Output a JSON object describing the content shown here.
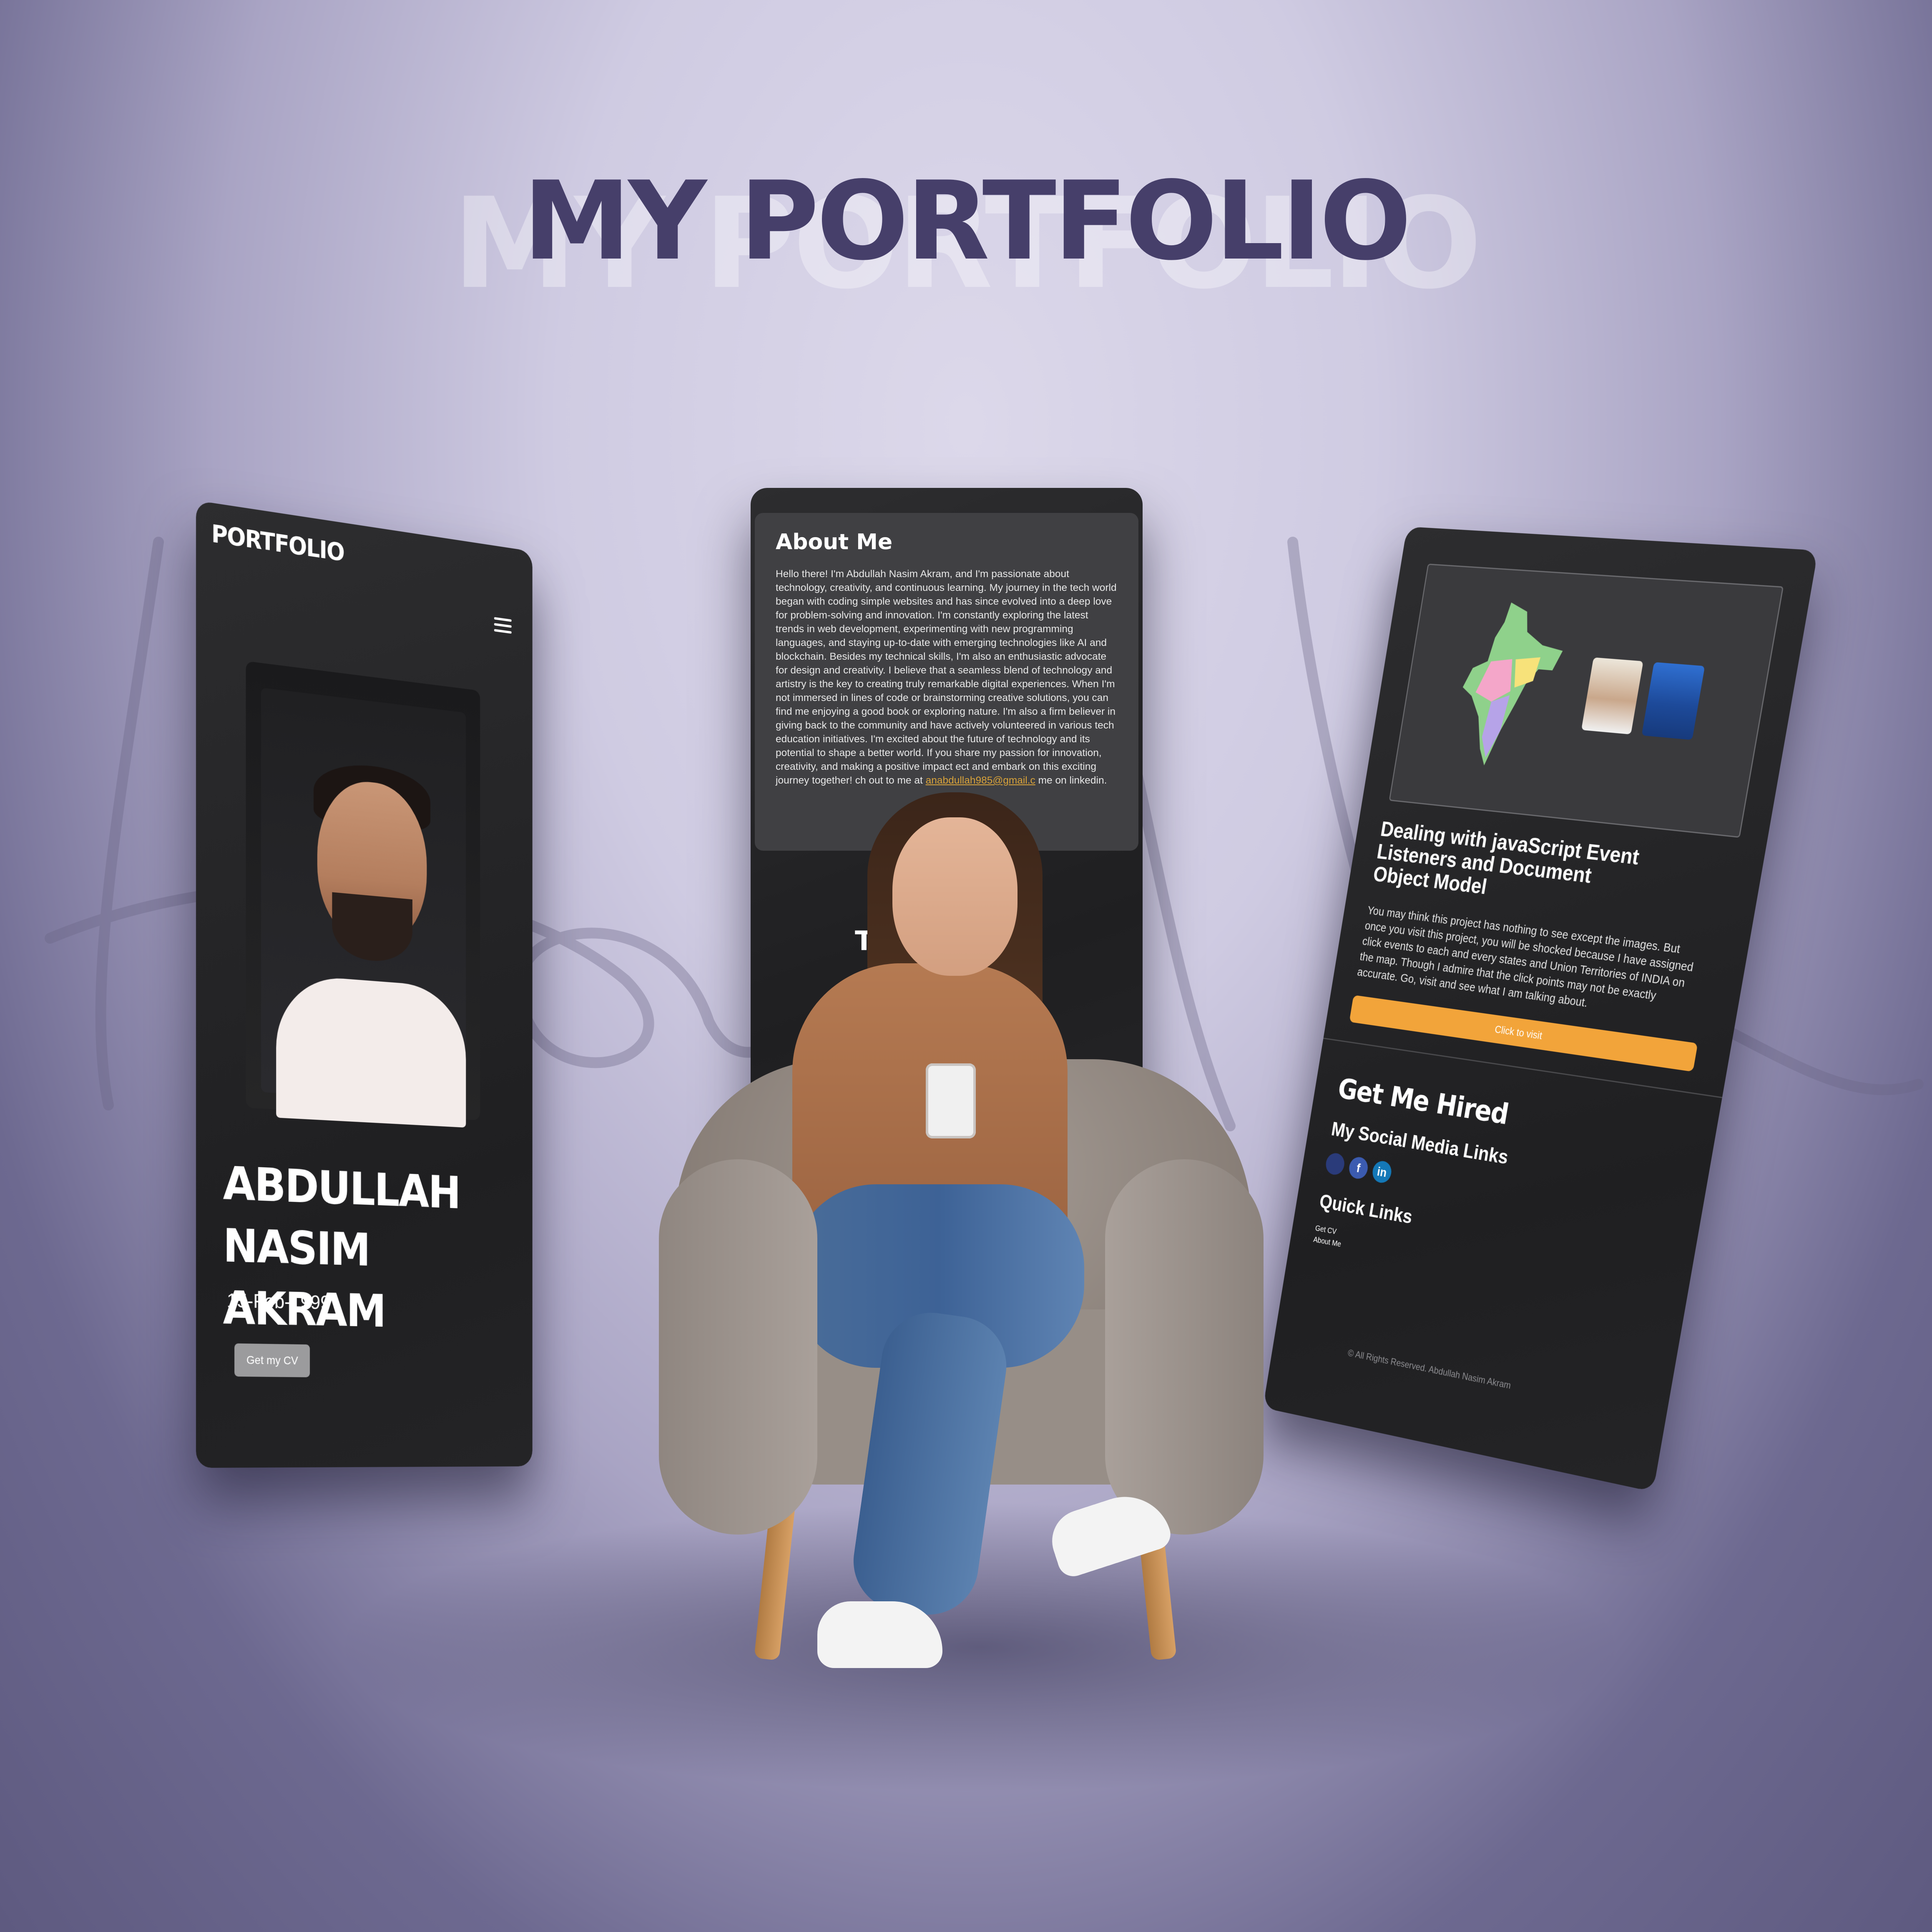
{
  "page": {
    "title": "MY PORTFOLIO",
    "title_shadow": "MY PORTFOLIO"
  },
  "colors": {
    "title": "#463f6a",
    "panel_bg": "#2a2a2c",
    "accent_button": "#f2a43a",
    "link": "#d8a23a"
  },
  "left_panel": {
    "brand": "PORTFOLIO",
    "menu_icon": "hamburger-menu-icon",
    "name_line1": "ABDULLAH",
    "name_line2": "NASIM AKRAM",
    "dob": "15-Feb-1999",
    "cv_button": "Get my CV"
  },
  "center_panel": {
    "about_title": "About Me",
    "about_text": "Hello there! I'm Abdullah Nasim Akram, and I'm passionate about technology, creativity, and continuous learning. My journey in the tech world began with coding simple websites and has since evolved into a deep love for problem-solving and innovation. I'm constantly exploring the latest trends in web development, experimenting with new programming languages, and staying up-to-date with emerging technologies like AI and blockchain. Besides my technical skills, I'm also an enthusiastic advocate for design and creativity. I believe that a seamless blend of technology and artistry is the key to creating truly remarkable digital experiences. When I'm not immersed in lines of code or brainstorming creative solutions, you can find me enjoying a good book or exploring nature. I'm also a firm believer in giving back to the community and have actively volunteered in various tech education initiatives. I'm excited about the future of technology and its potential to shape a better world. If you share my passion for innovation, creativity, and making a positive impact",
    "about_text_tail": "ect and embark on this exciting journey together!",
    "about_text_tail2": "ch out to me at",
    "email": "anabdullah985@gmail.c",
    "email_tail": "me on linkedin.",
    "lower_text": "T        AT"
  },
  "right_panel": {
    "project_title": "Dealing with javaScript Event Listeners and Document Object Model",
    "project_desc": "You may think this project has nothing to see except the images. But once you visit this project, you will be shocked because I have assigned click events to each and every states and Union Territories of INDIA on the map. Though I admire that the click points may not be exactly accurate. Go, visit and see what I am talking about.",
    "visit_button": "Click to visit",
    "hired_title": "Get Me Hired",
    "social_title": "My Social Media Links",
    "social": [
      "github-icon",
      "facebook-icon",
      "linkedin-icon"
    ],
    "social_glyphs": [
      "",
      "f",
      "in"
    ],
    "quick_title": "Quick Links",
    "quick_links": [
      "Get CV",
      "About Me"
    ],
    "copyright": "© All Rights Reserved. Abdullah Nasim Akram"
  }
}
